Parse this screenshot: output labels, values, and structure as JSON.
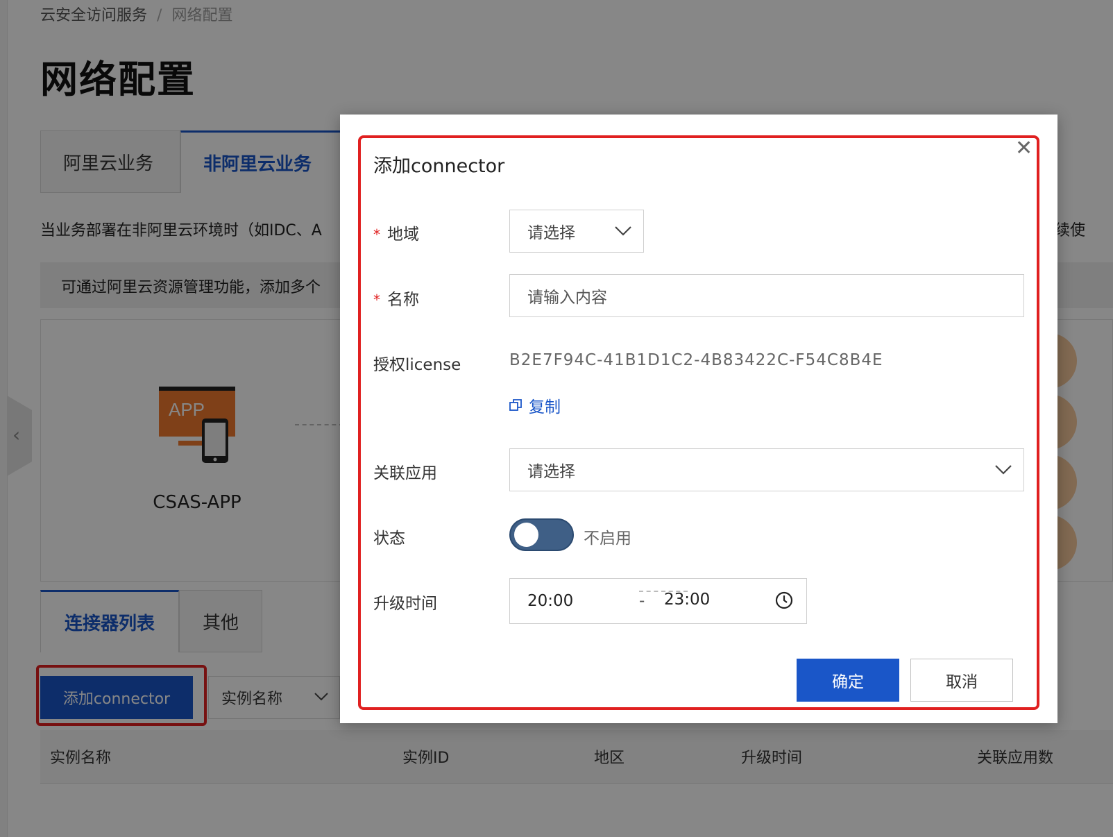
{
  "breadcrumb": {
    "root": "云安全访问服务",
    "separator": "/",
    "current": "网络配置"
  },
  "page": {
    "title": "网络配置",
    "tabs": [
      {
        "label": "阿里云业务"
      },
      {
        "label": "非阿里云业务"
      }
    ],
    "description": "当业务部署在非阿里云环境时（如IDC、A",
    "description_right": "续使",
    "info": "可通过阿里云资源管理功能，添加多个",
    "diagram": {
      "app_icon_text": "APP",
      "app_label": "CSAS-APP"
    },
    "sub_tabs": [
      {
        "label": "连接器列表"
      },
      {
        "label": "其他"
      }
    ],
    "add_button_label": "添加connector",
    "instance_filter_label": "实例名称",
    "table_headers": [
      "实例名称",
      "实例ID",
      "地区",
      "升级时间",
      "关联应用数"
    ]
  },
  "modal": {
    "title": "添加connector",
    "fields": {
      "region": {
        "label": "地域",
        "required": true,
        "placeholder": "请选择"
      },
      "name": {
        "label": "名称",
        "required": true,
        "placeholder": "请输入内容"
      },
      "license": {
        "label": "授权license",
        "value": "B2E7F94C-41B1D1C2-4B83422C-F54C8B4E",
        "copy_label": "复制"
      },
      "app": {
        "label": "关联应用",
        "placeholder": "请选择"
      },
      "status": {
        "label": "状态",
        "toggle_text": "不启用"
      },
      "upgrade": {
        "label": "升级时间",
        "start": "20:00",
        "separator": "-",
        "end": "23:00"
      }
    },
    "buttons": {
      "ok": "确定",
      "cancel": "取消"
    }
  },
  "colors": {
    "primary": "#1a56c8",
    "highlight": "#e02020",
    "toggle_off": "#3f5f86"
  }
}
